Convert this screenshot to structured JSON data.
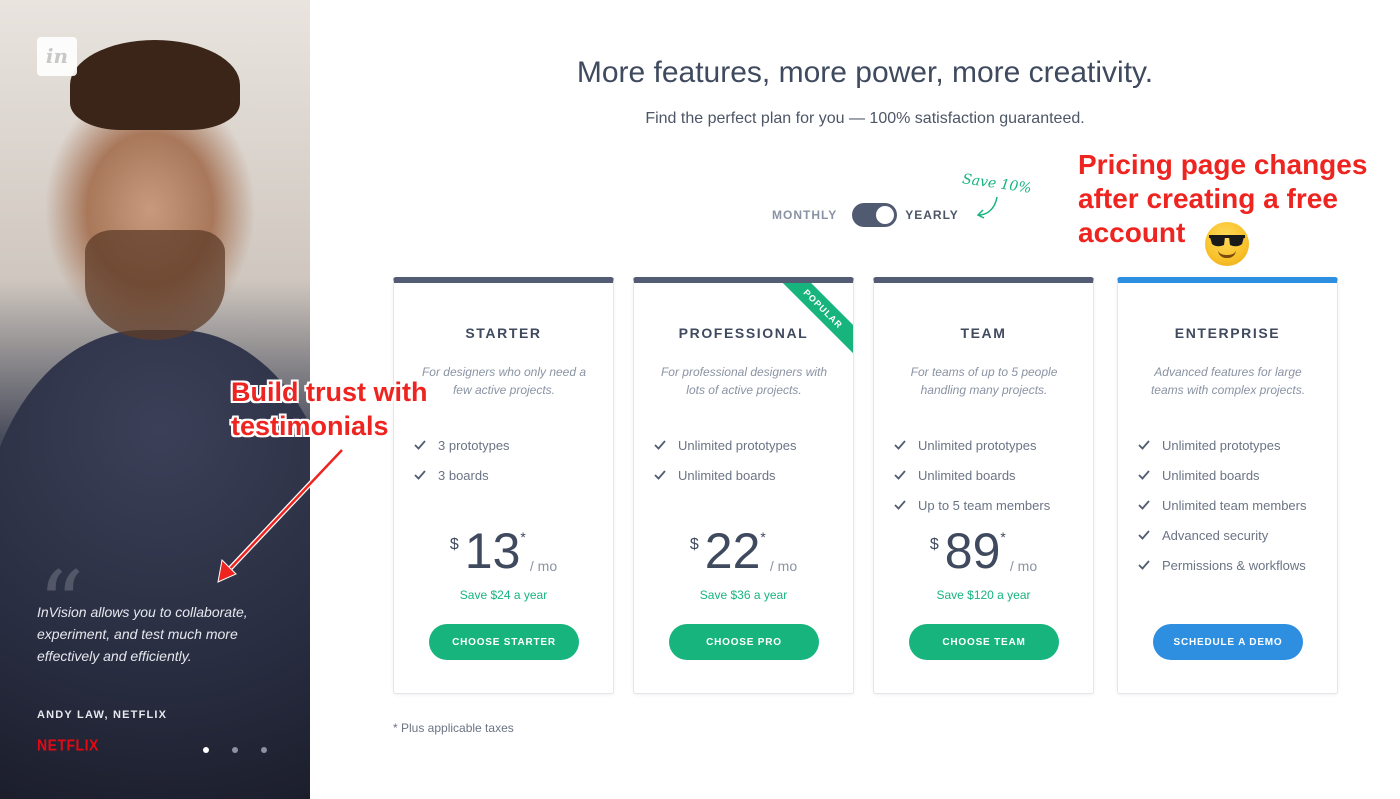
{
  "logo": {
    "text": "in",
    "icon": "invision-logo"
  },
  "testimonial": {
    "quote": "InVision allows you to collaborate, experiment, and test much more effectively and efficiently.",
    "author": "ANDY LAW, NETFLIX",
    "company_logo": "NETFLIX",
    "pagination_count": 3,
    "pagination_active": 0
  },
  "header": {
    "title": "More features, more power, more creativity.",
    "subtitle": "Find the perfect plan for you — 100% satisfaction guaranteed."
  },
  "billing_toggle": {
    "monthly_label": "MONTHLY",
    "yearly_label": "YEARLY",
    "selected": "yearly",
    "save_note": "Save 10%"
  },
  "plans": [
    {
      "name": "STARTER",
      "description": "For designers who only need a few active projects.",
      "features": [
        "3 prototypes",
        "3 boards"
      ],
      "currency": "$",
      "price": "13",
      "asterisk": "*",
      "period": "/ mo",
      "savings": "Save $24 a year",
      "cta": "CHOOSE STARTER"
    },
    {
      "name": "PROFESSIONAL",
      "badge": "POPULAR",
      "description": "For professional designers with lots of active projects.",
      "features": [
        "Unlimited prototypes",
        "Unlimited boards"
      ],
      "currency": "$",
      "price": "22",
      "asterisk": "*",
      "period": "/ mo",
      "savings": "Save $36 a year",
      "cta": "CHOOSE PRO"
    },
    {
      "name": "TEAM",
      "description": "For teams of up to 5 people handling many projects.",
      "features": [
        "Unlimited prototypes",
        "Unlimited boards",
        "Up to 5 team members"
      ],
      "currency": "$",
      "price": "89",
      "asterisk": "*",
      "period": "/ mo",
      "savings": "Save $120 a year",
      "cta": "CHOOSE TEAM"
    },
    {
      "name": "ENTERPRISE",
      "description": "Advanced features for large teams with complex projects.",
      "features": [
        "Unlimited prototypes",
        "Unlimited boards",
        "Unlimited team members",
        "Advanced security",
        "Permissions & workflows"
      ],
      "cta": "SCHEDULE A DEMO"
    }
  ],
  "footnote": "* Plus applicable taxes",
  "annotations": {
    "trust_line1": "Build trust with",
    "trust_line2": "testimonials",
    "pricing_line1": "Pricing page changes",
    "pricing_line2": "after creating a free",
    "pricing_line3": "account"
  },
  "colors": {
    "accent_green": "#17b47e",
    "accent_blue": "#2e8fe0",
    "card_top": "#525c72",
    "annotation_red": "#ee2420",
    "netflix_red": "#e50914"
  }
}
